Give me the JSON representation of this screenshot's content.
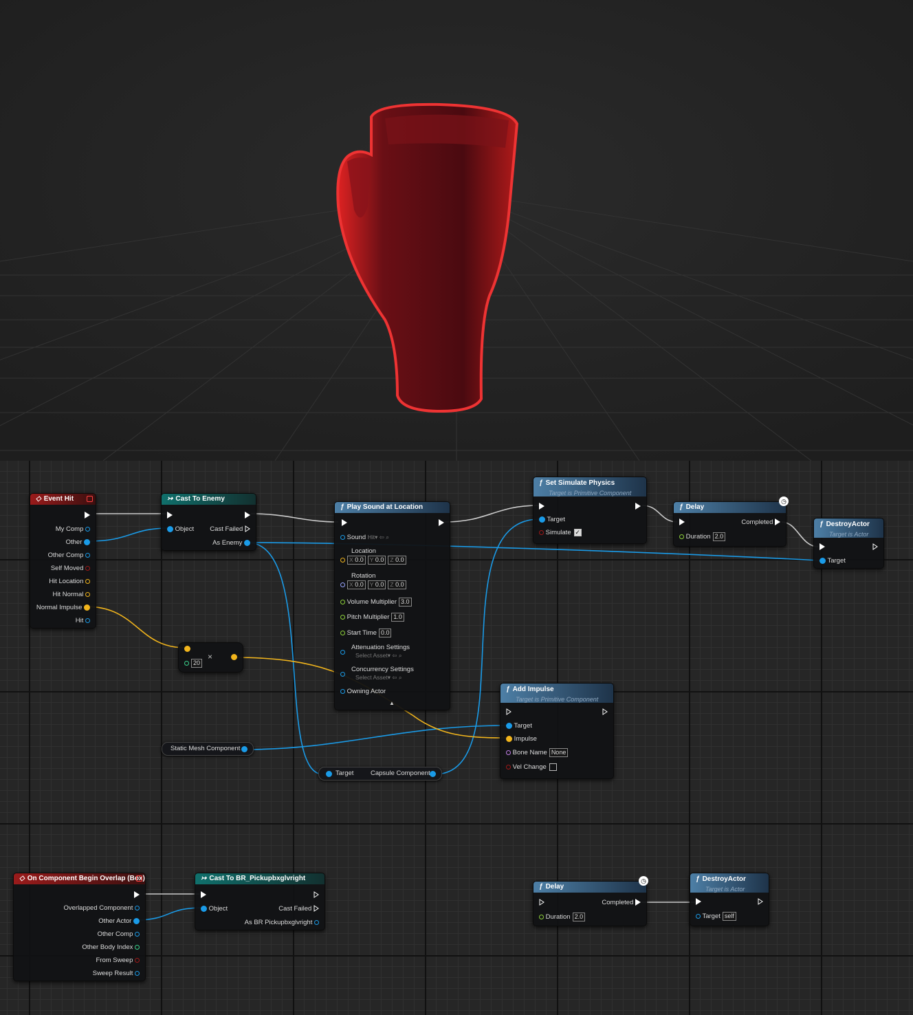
{
  "viewport": {
    "object": "boxing-glove-mesh"
  },
  "nodes": {
    "event_hit": {
      "title": "Event Hit",
      "pins": [
        "My Comp",
        "Other",
        "Other Comp",
        "Self Moved",
        "Hit Location",
        "Hit Normal",
        "Normal Impulse",
        "Hit"
      ]
    },
    "cast_enemy": {
      "title": "Cast To Enemy",
      "object": "Object",
      "cast_failed": "Cast Failed",
      "as_enemy": "As Enemy"
    },
    "multiply": {
      "operator": "×",
      "value": "20"
    },
    "play_sound": {
      "title": "Play Sound at Location",
      "sound": "Sound",
      "sound_value": "Hit",
      "location": "Location",
      "rotation": "Rotation",
      "x": "X",
      "y": "Y",
      "z": "Z",
      "zero": "0.0",
      "volume": "Volume Multiplier",
      "volume_value": "3.0",
      "pitch": "Pitch Multiplier",
      "pitch_value": "1.0",
      "start": "Start Time",
      "start_value": "0.0",
      "attenuation": "Attenuation Settings",
      "concurrency": "Concurrency Settings",
      "select_asset": "Select Asset",
      "owning": "Owning Actor"
    },
    "set_sim": {
      "title": "Set Simulate Physics",
      "subtitle": "Target is Primitive Component",
      "target": "Target",
      "simulate": "Simulate"
    },
    "delay1": {
      "title": "Delay",
      "completed": "Completed",
      "duration": "Duration",
      "duration_value": "2.0"
    },
    "destroy1": {
      "title": "DestroyActor",
      "subtitle": "Target is Actor",
      "target": "Target"
    },
    "add_impulse": {
      "title": "Add Impulse",
      "subtitle": "Target is Primitive Component",
      "target": "Target",
      "impulse": "Impulse",
      "bone": "Bone Name",
      "bone_value": "None",
      "vel": "Vel Change"
    },
    "static_mesh": {
      "label": "Static Mesh Component"
    },
    "capsule": {
      "target": "Target",
      "label": "Capsule Component"
    },
    "overlap": {
      "title": "On Component Begin Overlap (Box)",
      "pins": [
        "Overlapped Component",
        "Other Actor",
        "Other Comp",
        "Other Body Index",
        "From Sweep",
        "Sweep Result"
      ]
    },
    "cast_br": {
      "title": "Cast To BR_Pickupbxglvright",
      "object": "Object",
      "cast_failed": "Cast Failed",
      "as_br": "As BR Pickupbxglvright"
    },
    "delay2": {
      "title": "Delay",
      "completed": "Completed",
      "duration": "Duration",
      "duration_value": "2.0"
    },
    "destroy2": {
      "title": "DestroyActor",
      "subtitle": "Target is Actor",
      "target": "Target",
      "target_value": "self"
    }
  },
  "colors": {
    "object": "#1a9be8",
    "struct": "#f2b51c",
    "bool": "#a01818",
    "float": "#8fd33b",
    "exec": "#ffffff",
    "name": "#c27fe8",
    "rotator": "#9aa6ff"
  }
}
